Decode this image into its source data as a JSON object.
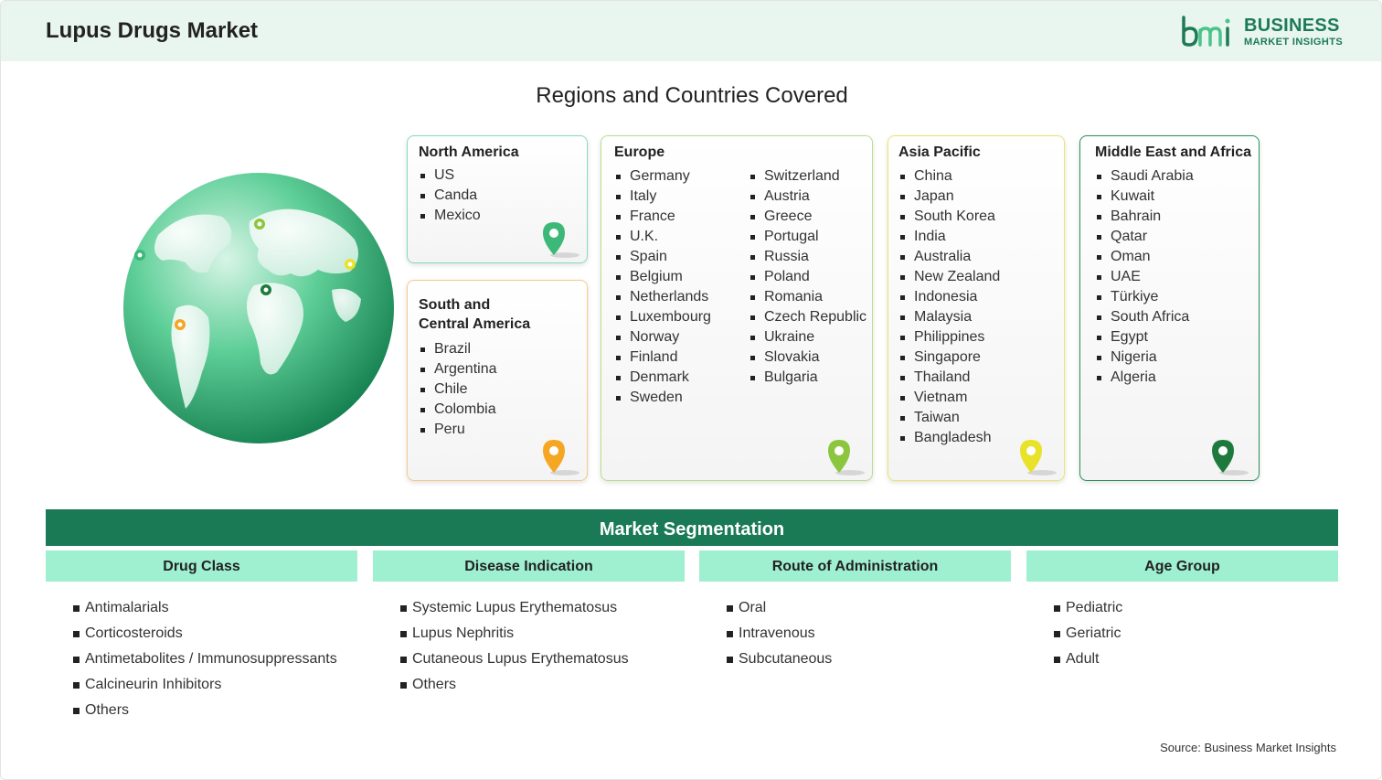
{
  "header": {
    "title": "Lupus Drugs Market"
  },
  "logo": {
    "line1": "BUSINESS",
    "line2": "MARKET INSIGHTS",
    "icon": "bmi-logo-icon"
  },
  "section_title": "Regions and Countries Covered",
  "colors": {
    "brand": "#1a7a56",
    "header_bg": "#e8f6ef",
    "segment_head_bg": "#9ff0d0"
  },
  "regions": {
    "north_america": {
      "name": "North America",
      "countries": [
        "US",
        "Canda",
        "Mexico"
      ],
      "pin_color": "#3cb878"
    },
    "south_america": {
      "name_line1": "South and",
      "name_line2": "Central America",
      "countries": [
        "Brazil",
        "Argentina",
        "Chile",
        "Colombia",
        "Peru"
      ],
      "pin_color": "#f5a623"
    },
    "europe": {
      "name": "Europe",
      "col1": [
        "Germany",
        "Italy",
        "France",
        "U.K.",
        "Spain",
        "Belgium",
        "Netherlands",
        "Luxembourg",
        "Norway",
        "Finland",
        "Denmark",
        "Sweden"
      ],
      "col2": [
        "Switzerland",
        "Austria",
        "Greece",
        "Portugal",
        "Russia",
        "Poland",
        "Romania",
        "Czech Republic",
        "Ukraine",
        "Slovakia",
        "Bulgaria"
      ],
      "pin_color": "#8cc63f"
    },
    "asia_pacific": {
      "name": "Asia Pacific",
      "countries": [
        "China",
        "Japan",
        "South Korea",
        "India",
        "Australia",
        "New Zealand",
        "Indonesia",
        "Malaysia",
        "Philippines",
        "Singapore",
        "Thailand",
        "Vietnam",
        "Taiwan",
        "Bangladesh"
      ],
      "pin_color": "#e8e22a"
    },
    "mea": {
      "name": "Middle East and Africa",
      "countries": [
        "Saudi Arabia",
        "Kuwait",
        "Bahrain",
        "Qatar",
        "Oman",
        "UAE",
        "Türkiye",
        "South Africa",
        "Egypt",
        "Nigeria",
        "Algeria"
      ],
      "pin_color": "#1e7a3c"
    }
  },
  "segmentation": {
    "title": "Market Segmentation",
    "groups": [
      {
        "name": "Drug Class",
        "items": [
          "Antimalarials",
          "Corticosteroids",
          "Antimetabolites / Immunosuppressants",
          "Calcineurin Inhibitors",
          "Others"
        ]
      },
      {
        "name": "Disease Indication",
        "items": [
          "Systemic Lupus Erythematosus",
          "Lupus Nephritis",
          "Cutaneous Lupus Erythematosus",
          "Others"
        ]
      },
      {
        "name": "Route of Administration",
        "items": [
          "Oral",
          "Intravenous",
          "Subcutaneous"
        ]
      },
      {
        "name": "Age Group",
        "items": [
          "Pediatric",
          "Geriatric",
          "Adult"
        ]
      }
    ]
  },
  "source": "Source: Business Market Insights"
}
